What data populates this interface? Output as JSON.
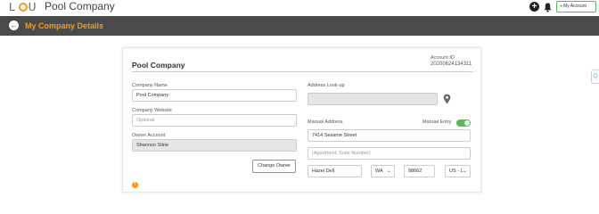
{
  "header": {
    "logo_text": "LOU",
    "app_title": "Pool Company",
    "account_button": "My Account"
  },
  "nav": {
    "title": "My Company Details"
  },
  "card": {
    "title": "Pool Company",
    "account_id_label": "Account ID",
    "account_id_value": "20200624134311",
    "company_name": {
      "label": "Company Name",
      "value": "Pool Company"
    },
    "company_website": {
      "label": "Company Website",
      "placeholder": "Optional"
    },
    "owner_account": {
      "label": "Owner Account",
      "value": "Shannon Stine"
    },
    "change_owner_button": "Change Owner",
    "address_lookup": {
      "label": "Address Look-up",
      "value": ""
    },
    "manual_address": {
      "label": "Manual Address",
      "value": "7414 Sesame Street"
    },
    "manual_entry": {
      "label": "Manual Entry",
      "enabled": true
    },
    "address_line2": {
      "placeholder": "(Apartment, Suite Number)"
    },
    "city": "Hazel Dell",
    "state": "WA",
    "zip": "98662",
    "country": "US - L"
  },
  "colors": {
    "accent": "#f39c12",
    "nav_bg": "#4a4a4a",
    "success": "#5cb85c"
  },
  "icons": {
    "add": "plus-circle-icon",
    "notifications": "bell-icon",
    "back": "arrow-left-circle-icon",
    "location": "map-pin-icon",
    "info": "info-icon"
  }
}
